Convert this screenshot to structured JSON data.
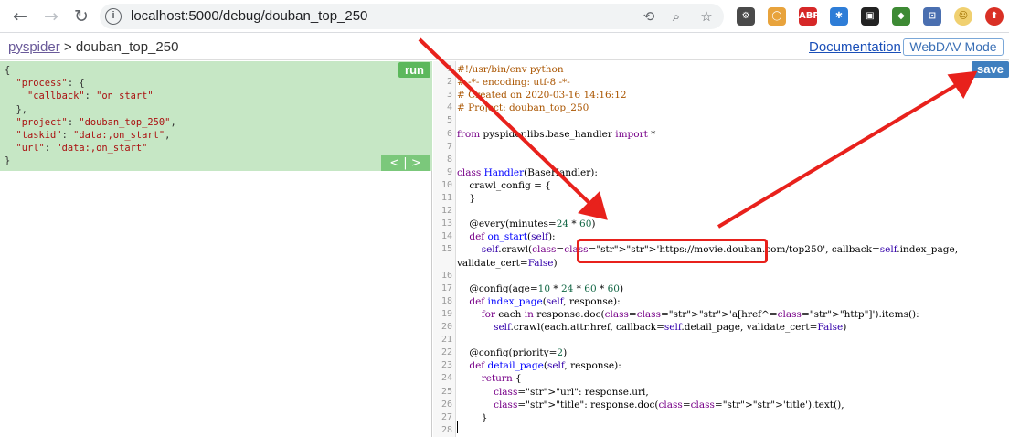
{
  "browser": {
    "url": "localhost:5000/debug/douban_top_250",
    "nav": {
      "back": "←",
      "forward": "→",
      "reload": "↻"
    },
    "icons": [
      "translate-icon",
      "zoom-icon",
      "star-icon"
    ],
    "extensions": [
      {
        "name": "ext-1-icon",
        "glyph": "⚙",
        "color": "#4a4a4a"
      },
      {
        "name": "ext-2-icon",
        "glyph": "◯",
        "color": "#e8a33c"
      },
      {
        "name": "adblock-icon",
        "glyph": "ABP",
        "color": "#d62828"
      },
      {
        "name": "ext-4-icon",
        "glyph": "✱",
        "color": "#2e7dd7"
      },
      {
        "name": "ext-5-icon",
        "glyph": "▣",
        "color": "#222"
      },
      {
        "name": "ext-6-icon",
        "glyph": "◆",
        "color": "#3d8a34"
      },
      {
        "name": "ext-7-icon",
        "glyph": "⊡",
        "color": "#4a6fb0"
      },
      {
        "name": "avatar-icon",
        "glyph": "☺",
        "color": "#f0d070"
      },
      {
        "name": "update-icon",
        "glyph": "⬆",
        "color": "#d93025"
      }
    ]
  },
  "header": {
    "brand": "pyspider",
    "separator": ">",
    "project": "douban_top_250",
    "documentation": "Documentation",
    "webdav": "WebDAV Mode"
  },
  "task_panel": {
    "run_label": "run",
    "pager_label": "<  |  >",
    "json_lines": [
      "{",
      "  \"process\": {",
      "    \"callback\": \"on_start\"",
      "  },",
      "  \"project\": \"douban_top_250\",",
      "  \"taskid\": \"data:,on_start\",",
      "  \"url\": \"data:,on_start\"",
      "}"
    ]
  },
  "editor": {
    "save_label": "save",
    "lines": [
      "#!/usr/bin/env python",
      "# -*- encoding: utf-8 -*-",
      "# Created on 2020-03-16 14:16:12",
      "# Project: douban_top_250",
      "",
      "from pyspider.libs.base_handler import *",
      "",
      "",
      "class Handler(BaseHandler):",
      "    crawl_config = {",
      "    }",
      "",
      "    @every(minutes=24 * 60)",
      "    def on_start(self):",
      "        self.crawl('https://movie.douban.com/top250', callback=self.index_page,",
      "validate_cert=False)",
      "",
      "    @config(age=10 * 24 * 60 * 60)",
      "    def index_page(self, response):",
      "        for each in response.doc('a[href^=\"http\"]').items():",
      "            self.crawl(each.attr.href, callback=self.detail_page, validate_cert=False)",
      "",
      "    @config(priority=2)",
      "    def detail_page(self, response):",
      "        return {",
      "            \"url\": response.url,",
      "            \"title\": response.doc('title').text(),",
      "        }",
      ""
    ],
    "line_numbers": [
      "1",
      "2",
      "3",
      "4",
      "5",
      "6",
      "7",
      "8",
      "9",
      "10",
      "11",
      "12",
      "13",
      "14",
      "15",
      "",
      "16",
      "17",
      "18",
      "19",
      "20",
      "21",
      "22",
      "23",
      "24",
      "25",
      "26",
      "27",
      "28"
    ]
  }
}
